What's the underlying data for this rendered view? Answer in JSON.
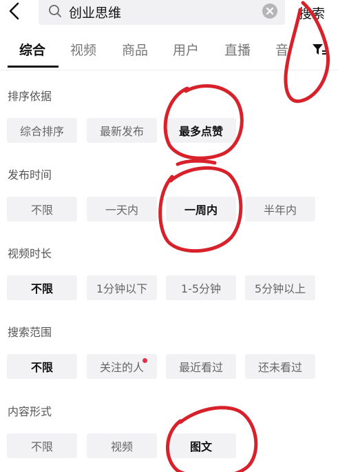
{
  "search": {
    "query": "创业思维",
    "submit_label": "搜索"
  },
  "tabs": [
    {
      "label": "综合",
      "active": true
    },
    {
      "label": "视频",
      "active": false
    },
    {
      "label": "商品",
      "active": false
    },
    {
      "label": "用户",
      "active": false
    },
    {
      "label": "直播",
      "active": false
    },
    {
      "label": "音",
      "active": false
    }
  ],
  "filters": [
    {
      "title": "排序依据",
      "options": [
        {
          "label": "综合排序",
          "selected": false
        },
        {
          "label": "最新发布",
          "selected": false
        },
        {
          "label": "最多点赞",
          "selected": true
        }
      ]
    },
    {
      "title": "发布时间",
      "options": [
        {
          "label": "不限",
          "selected": false
        },
        {
          "label": "一天内",
          "selected": false
        },
        {
          "label": "一周内",
          "selected": true
        },
        {
          "label": "半年内",
          "selected": false
        }
      ]
    },
    {
      "title": "视频时长",
      "options": [
        {
          "label": "不限",
          "selected": true
        },
        {
          "label": "1分钟以下",
          "selected": false
        },
        {
          "label": "1-5分钟",
          "selected": false
        },
        {
          "label": "5分钟以上",
          "selected": false
        }
      ]
    },
    {
      "title": "搜索范围",
      "options": [
        {
          "label": "不限",
          "selected": true
        },
        {
          "label": "关注的人",
          "selected": false,
          "badge_dot": true
        },
        {
          "label": "最近看过",
          "selected": false
        },
        {
          "label": "还未看过",
          "selected": false
        }
      ]
    },
    {
      "title": "内容形式",
      "options": [
        {
          "label": "不限",
          "selected": false
        },
        {
          "label": "视频",
          "selected": false
        },
        {
          "label": "图文",
          "selected": true
        }
      ]
    }
  ],
  "colors": {
    "chip_background": "#f2f2f4",
    "badge_dot": "#e0304a",
    "annotation_red": "#d8222b"
  },
  "icons": [
    "back-arrow-icon",
    "search-icon",
    "clear-icon",
    "filter-icon"
  ]
}
